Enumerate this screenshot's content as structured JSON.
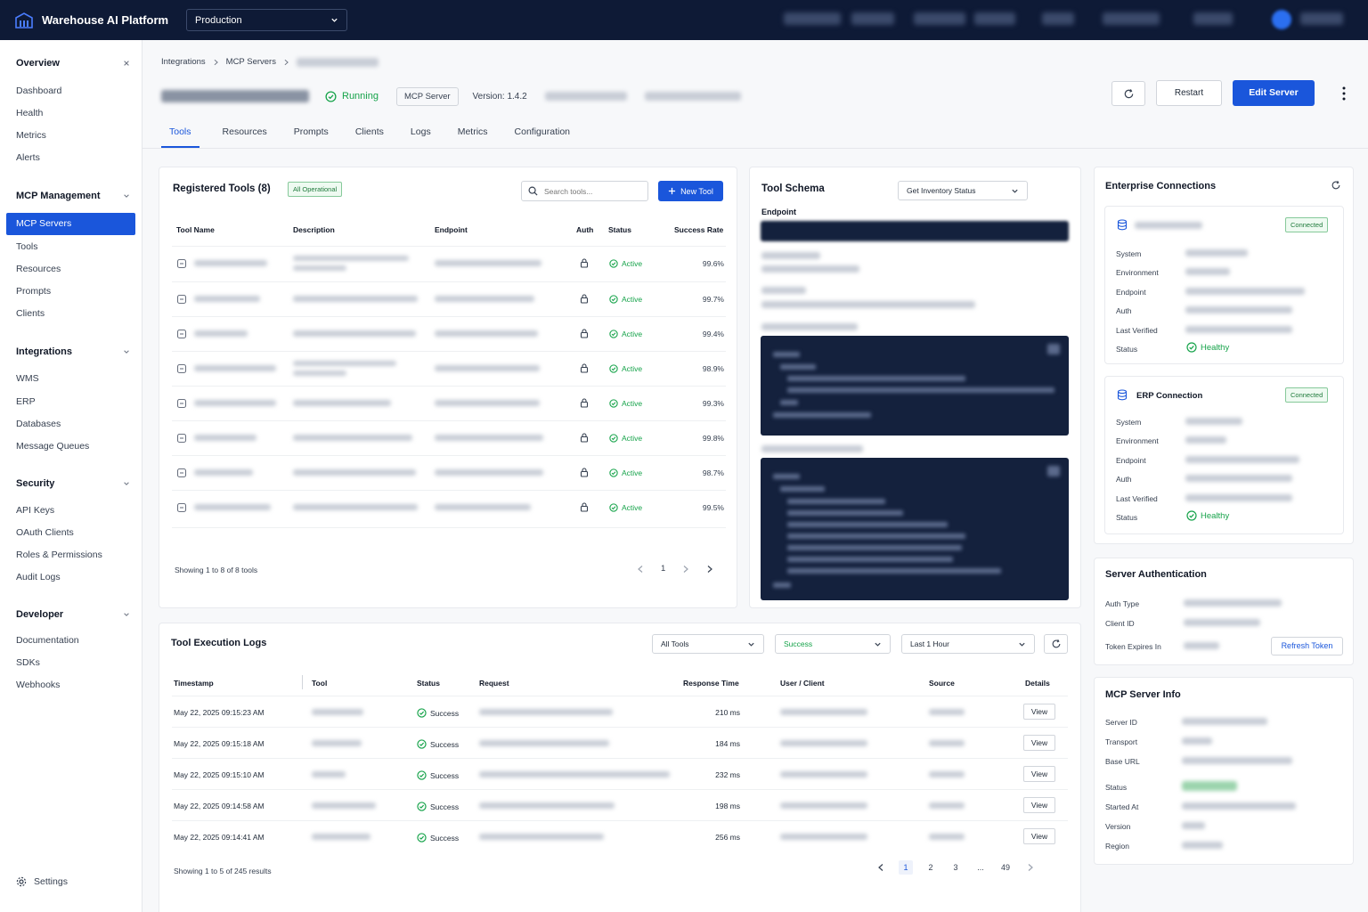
{
  "topbar": {
    "brand": "Warehouse AI Platform",
    "environment": "Production"
  },
  "sidebar": {
    "overview": {
      "title": "Overview",
      "items": [
        "Dashboard",
        "Health",
        "Metrics",
        "Alerts"
      ]
    },
    "mcp": {
      "title": "MCP Management",
      "active": "MCP Servers",
      "items": [
        "Tools",
        "Resources",
        "Prompts",
        "Clients"
      ]
    },
    "integrations": {
      "title": "Integrations",
      "items": [
        "WMS",
        "ERP",
        "Databases",
        "Message Queues"
      ]
    },
    "security": {
      "title": "Security",
      "items": [
        "API Keys",
        "OAuth Clients",
        "Roles & Permissions",
        "Audit Logs"
      ]
    },
    "developer": {
      "title": "Developer",
      "items": [
        "Documentation",
        "SDKs",
        "Webhooks"
      ]
    },
    "settings": "Settings"
  },
  "breadcrumb": [
    "Integrations",
    "MCP Servers"
  ],
  "header": {
    "status": "Running",
    "type_tag": "MCP Server",
    "version": "Version: 1.4.2",
    "restart": "Restart",
    "edit": "Edit Server"
  },
  "tabs": [
    "Tools",
    "Resources",
    "Prompts",
    "Clients",
    "Logs",
    "Metrics",
    "Configuration"
  ],
  "tools": {
    "title": "Registered Tools (8)",
    "badge": "All Operational",
    "search_placeholder": "Search tools...",
    "new_tool": "New Tool",
    "columns": [
      "Tool Name",
      "Description",
      "Endpoint",
      "Auth",
      "Status",
      "Success Rate"
    ],
    "rows": [
      {
        "status": "Active",
        "rate": "99.6%"
      },
      {
        "status": "Active",
        "rate": "99.7%"
      },
      {
        "status": "Active",
        "rate": "99.4%"
      },
      {
        "status": "Active",
        "rate": "98.9%"
      },
      {
        "status": "Active",
        "rate": "99.3%"
      },
      {
        "status": "Active",
        "rate": "99.8%"
      },
      {
        "status": "Active",
        "rate": "98.7%"
      },
      {
        "status": "Active",
        "rate": "99.5%"
      }
    ],
    "showing": "Showing 1 to 8 of 8 tools",
    "page": "1"
  },
  "schema": {
    "title": "Tool Schema",
    "selected": "Get Inventory Status",
    "endpoint_label": "Endpoint"
  },
  "enterprise": {
    "title": "Enterprise Connections",
    "labels": [
      "System",
      "Environment",
      "Endpoint",
      "Auth",
      "Last Verified",
      "Status"
    ],
    "wms": {
      "badge": "Connected",
      "status": "Healthy"
    },
    "erp": {
      "name": "ERP Connection",
      "badge": "Connected",
      "status": "Healthy"
    }
  },
  "auth": {
    "title": "Server Authentication",
    "labels": [
      "Auth Type",
      "Client ID",
      "Token Expires In"
    ],
    "refresh": "Refresh Token"
  },
  "info": {
    "title": "MCP Server Info",
    "labels": [
      "Server ID",
      "Transport",
      "Base URL",
      "Status",
      "Started At",
      "Version",
      "Region"
    ]
  },
  "logs": {
    "title": "Tool Execution Logs",
    "filters": [
      "All Tools",
      "Success",
      "Last 1 Hour"
    ],
    "columns": [
      "Timestamp",
      "Tool",
      "Status",
      "Request",
      "Response Time",
      "User / Client",
      "Source",
      "Details"
    ],
    "rows": [
      {
        "ts": "May 22, 2025 09:15:23 AM",
        "status": "Success",
        "rt": "210 ms",
        "view": "View"
      },
      {
        "ts": "May 22, 2025 09:15:18 AM",
        "status": "Success",
        "rt": "184 ms",
        "view": "View"
      },
      {
        "ts": "May 22, 2025 09:15:10 AM",
        "status": "Success",
        "rt": "232 ms",
        "view": "View"
      },
      {
        "ts": "May 22, 2025 09:14:58 AM",
        "status": "Success",
        "rt": "198 ms",
        "view": "View"
      },
      {
        "ts": "May 22, 2025 09:14:41 AM",
        "status": "Success",
        "rt": "256 ms",
        "view": "View"
      }
    ],
    "showing": "Showing 1 to 5 of 245 results",
    "pages": [
      "1",
      "2",
      "3",
      "...",
      "49"
    ]
  },
  "colors": {
    "primary": "#1a56db",
    "topbar": "#0e1a36",
    "success": "#16a34a"
  }
}
